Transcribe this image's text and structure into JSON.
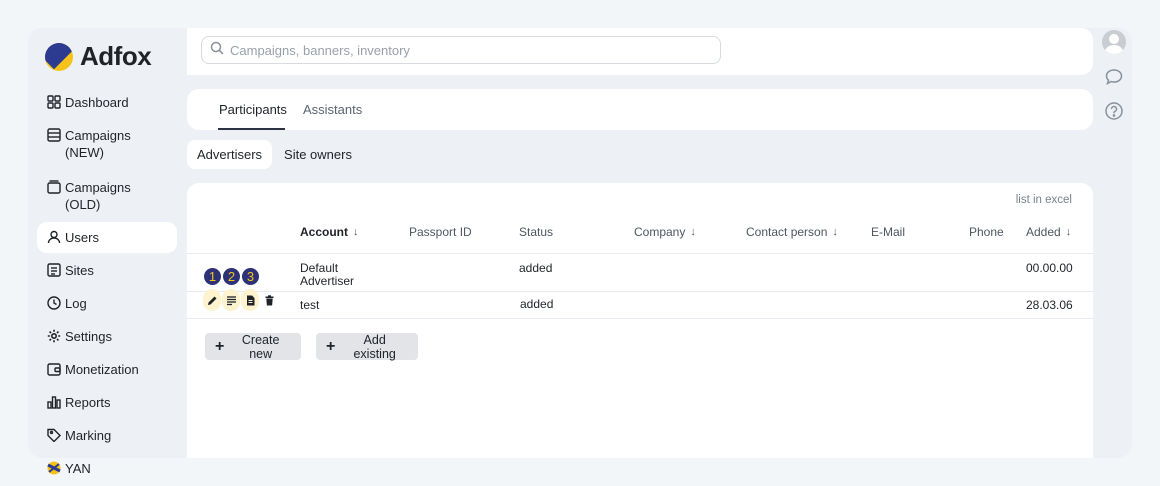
{
  "brand": {
    "name": "Adfox"
  },
  "search": {
    "placeholder": "Campaigns, banners, inventory"
  },
  "sidebar": {
    "items": [
      {
        "label": "Dashboard",
        "icon": "grid-icon"
      },
      {
        "label": "Campaigns (NEW)",
        "icon": "list-box-icon"
      },
      {
        "label": "Campaigns (OLD)",
        "icon": "folder-box-icon"
      },
      {
        "label": "Users",
        "icon": "user-icon",
        "active": true
      },
      {
        "label": "Sites",
        "icon": "sites-icon"
      },
      {
        "label": "Log",
        "icon": "clock-icon"
      },
      {
        "label": "Settings",
        "icon": "gear-icon"
      },
      {
        "label": "Monetization",
        "icon": "wallet-icon"
      },
      {
        "label": "Reports",
        "icon": "bar-chart-icon"
      },
      {
        "label": "Marking",
        "icon": "tag-icon"
      },
      {
        "label": "YAN",
        "icon": "yan-icon"
      }
    ]
  },
  "tabs": {
    "participants": "Participants",
    "assistants": "Assistants"
  },
  "subtabs": {
    "advertisers": "Advertisers",
    "site_owners": "Site owners"
  },
  "table": {
    "excel_link": "list in excel",
    "headers": {
      "account": "Account",
      "passport_id": "Passport ID",
      "status": "Status",
      "company": "Company",
      "contact_person": "Contact person",
      "email": "E-Mail",
      "phone": "Phone",
      "added": "Added"
    },
    "rows": [
      {
        "account_line1": "Default",
        "account_line2": "Advertiser",
        "status": "added",
        "added": "00.00.00"
      },
      {
        "account": "test",
        "status": "added",
        "added": "28.03.06"
      }
    ],
    "badges": [
      "1",
      "2",
      "3"
    ],
    "row_actions": [
      "pencil-icon",
      "lines-icon",
      "document-icon",
      "trash-icon"
    ]
  },
  "buttons": {
    "create_new": "Create new",
    "add_existing": "Add existing"
  },
  "colors": {
    "accent_dark": "#2c3275",
    "accent_yellow": "#f6c21a",
    "highlight": "#fdf3cf"
  }
}
